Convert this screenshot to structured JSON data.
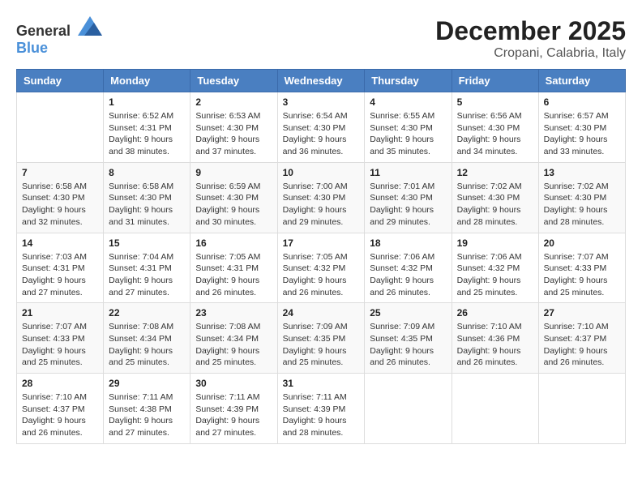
{
  "logo": {
    "general": "General",
    "blue": "Blue"
  },
  "header": {
    "month": "December 2025",
    "location": "Cropani, Calabria, Italy"
  },
  "weekdays": [
    "Sunday",
    "Monday",
    "Tuesday",
    "Wednesday",
    "Thursday",
    "Friday",
    "Saturday"
  ],
  "weeks": [
    [
      {
        "day": "",
        "sunrise": "",
        "sunset": "",
        "daylight": "",
        "empty": true
      },
      {
        "day": "1",
        "sunrise": "Sunrise: 6:52 AM",
        "sunset": "Sunset: 4:31 PM",
        "daylight": "Daylight: 9 hours and 38 minutes."
      },
      {
        "day": "2",
        "sunrise": "Sunrise: 6:53 AM",
        "sunset": "Sunset: 4:30 PM",
        "daylight": "Daylight: 9 hours and 37 minutes."
      },
      {
        "day": "3",
        "sunrise": "Sunrise: 6:54 AM",
        "sunset": "Sunset: 4:30 PM",
        "daylight": "Daylight: 9 hours and 36 minutes."
      },
      {
        "day": "4",
        "sunrise": "Sunrise: 6:55 AM",
        "sunset": "Sunset: 4:30 PM",
        "daylight": "Daylight: 9 hours and 35 minutes."
      },
      {
        "day": "5",
        "sunrise": "Sunrise: 6:56 AM",
        "sunset": "Sunset: 4:30 PM",
        "daylight": "Daylight: 9 hours and 34 minutes."
      },
      {
        "day": "6",
        "sunrise": "Sunrise: 6:57 AM",
        "sunset": "Sunset: 4:30 PM",
        "daylight": "Daylight: 9 hours and 33 minutes."
      }
    ],
    [
      {
        "day": "7",
        "sunrise": "Sunrise: 6:58 AM",
        "sunset": "Sunset: 4:30 PM",
        "daylight": "Daylight: 9 hours and 32 minutes."
      },
      {
        "day": "8",
        "sunrise": "Sunrise: 6:58 AM",
        "sunset": "Sunset: 4:30 PM",
        "daylight": "Daylight: 9 hours and 31 minutes."
      },
      {
        "day": "9",
        "sunrise": "Sunrise: 6:59 AM",
        "sunset": "Sunset: 4:30 PM",
        "daylight": "Daylight: 9 hours and 30 minutes."
      },
      {
        "day": "10",
        "sunrise": "Sunrise: 7:00 AM",
        "sunset": "Sunset: 4:30 PM",
        "daylight": "Daylight: 9 hours and 29 minutes."
      },
      {
        "day": "11",
        "sunrise": "Sunrise: 7:01 AM",
        "sunset": "Sunset: 4:30 PM",
        "daylight": "Daylight: 9 hours and 29 minutes."
      },
      {
        "day": "12",
        "sunrise": "Sunrise: 7:02 AM",
        "sunset": "Sunset: 4:30 PM",
        "daylight": "Daylight: 9 hours and 28 minutes."
      },
      {
        "day": "13",
        "sunrise": "Sunrise: 7:02 AM",
        "sunset": "Sunset: 4:30 PM",
        "daylight": "Daylight: 9 hours and 28 minutes."
      }
    ],
    [
      {
        "day": "14",
        "sunrise": "Sunrise: 7:03 AM",
        "sunset": "Sunset: 4:31 PM",
        "daylight": "Daylight: 9 hours and 27 minutes."
      },
      {
        "day": "15",
        "sunrise": "Sunrise: 7:04 AM",
        "sunset": "Sunset: 4:31 PM",
        "daylight": "Daylight: 9 hours and 27 minutes."
      },
      {
        "day": "16",
        "sunrise": "Sunrise: 7:05 AM",
        "sunset": "Sunset: 4:31 PM",
        "daylight": "Daylight: 9 hours and 26 minutes."
      },
      {
        "day": "17",
        "sunrise": "Sunrise: 7:05 AM",
        "sunset": "Sunset: 4:32 PM",
        "daylight": "Daylight: 9 hours and 26 minutes."
      },
      {
        "day": "18",
        "sunrise": "Sunrise: 7:06 AM",
        "sunset": "Sunset: 4:32 PM",
        "daylight": "Daylight: 9 hours and 26 minutes."
      },
      {
        "day": "19",
        "sunrise": "Sunrise: 7:06 AM",
        "sunset": "Sunset: 4:32 PM",
        "daylight": "Daylight: 9 hours and 25 minutes."
      },
      {
        "day": "20",
        "sunrise": "Sunrise: 7:07 AM",
        "sunset": "Sunset: 4:33 PM",
        "daylight": "Daylight: 9 hours and 25 minutes."
      }
    ],
    [
      {
        "day": "21",
        "sunrise": "Sunrise: 7:07 AM",
        "sunset": "Sunset: 4:33 PM",
        "daylight": "Daylight: 9 hours and 25 minutes."
      },
      {
        "day": "22",
        "sunrise": "Sunrise: 7:08 AM",
        "sunset": "Sunset: 4:34 PM",
        "daylight": "Daylight: 9 hours and 25 minutes."
      },
      {
        "day": "23",
        "sunrise": "Sunrise: 7:08 AM",
        "sunset": "Sunset: 4:34 PM",
        "daylight": "Daylight: 9 hours and 25 minutes."
      },
      {
        "day": "24",
        "sunrise": "Sunrise: 7:09 AM",
        "sunset": "Sunset: 4:35 PM",
        "daylight": "Daylight: 9 hours and 25 minutes."
      },
      {
        "day": "25",
        "sunrise": "Sunrise: 7:09 AM",
        "sunset": "Sunset: 4:35 PM",
        "daylight": "Daylight: 9 hours and 26 minutes."
      },
      {
        "day": "26",
        "sunrise": "Sunrise: 7:10 AM",
        "sunset": "Sunset: 4:36 PM",
        "daylight": "Daylight: 9 hours and 26 minutes."
      },
      {
        "day": "27",
        "sunrise": "Sunrise: 7:10 AM",
        "sunset": "Sunset: 4:37 PM",
        "daylight": "Daylight: 9 hours and 26 minutes."
      }
    ],
    [
      {
        "day": "28",
        "sunrise": "Sunrise: 7:10 AM",
        "sunset": "Sunset: 4:37 PM",
        "daylight": "Daylight: 9 hours and 26 minutes."
      },
      {
        "day": "29",
        "sunrise": "Sunrise: 7:11 AM",
        "sunset": "Sunset: 4:38 PM",
        "daylight": "Daylight: 9 hours and 27 minutes."
      },
      {
        "day": "30",
        "sunrise": "Sunrise: 7:11 AM",
        "sunset": "Sunset: 4:39 PM",
        "daylight": "Daylight: 9 hours and 27 minutes."
      },
      {
        "day": "31",
        "sunrise": "Sunrise: 7:11 AM",
        "sunset": "Sunset: 4:39 PM",
        "daylight": "Daylight: 9 hours and 28 minutes."
      },
      {
        "day": "",
        "sunrise": "",
        "sunset": "",
        "daylight": "",
        "empty": true
      },
      {
        "day": "",
        "sunrise": "",
        "sunset": "",
        "daylight": "",
        "empty": true
      },
      {
        "day": "",
        "sunrise": "",
        "sunset": "",
        "daylight": "",
        "empty": true
      }
    ]
  ]
}
